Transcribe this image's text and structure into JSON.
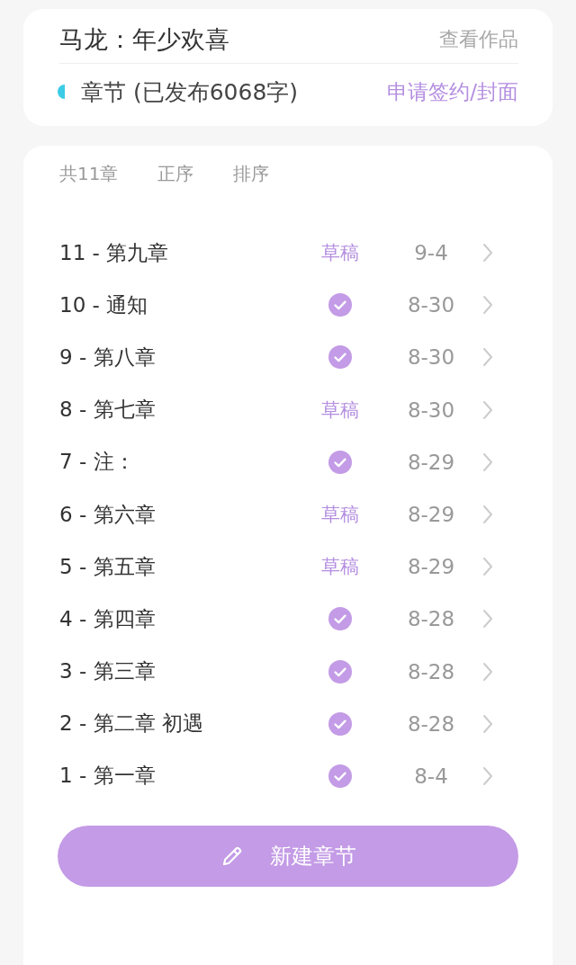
{
  "header": {
    "title": "马龙：年少欢喜",
    "link": "查看作品",
    "section": "章节 (已发布6068字)",
    "action": "申请签约/封面"
  },
  "toolbar": {
    "count": "共11章",
    "order": "正序",
    "sort": "排序"
  },
  "chapters": [
    {
      "title": "11 - 第九章",
      "kind": "draft",
      "status": "草稿",
      "date": "9-4"
    },
    {
      "title": "10 - 通知",
      "kind": "published",
      "date": "8-30"
    },
    {
      "title": "9 - 第八章",
      "kind": "published",
      "date": "8-30"
    },
    {
      "title": "8 - 第七章",
      "kind": "draft",
      "status": "草稿",
      "date": "8-30"
    },
    {
      "title": "7 - 注：",
      "kind": "published",
      "date": "8-29"
    },
    {
      "title": "6 - 第六章",
      "kind": "draft",
      "status": "草稿",
      "date": "8-29"
    },
    {
      "title": "5 - 第五章",
      "kind": "draft",
      "status": "草稿",
      "date": "8-29"
    },
    {
      "title": "4 - 第四章",
      "kind": "published",
      "date": "8-28"
    },
    {
      "title": "3 - 第三章",
      "kind": "published",
      "date": "8-28"
    },
    {
      "title": "2 - 第二章 初遇",
      "kind": "published",
      "date": "8-28"
    },
    {
      "title": "1 - 第一章",
      "kind": "published",
      "date": "8-4"
    }
  ],
  "new_button": "新建章节"
}
